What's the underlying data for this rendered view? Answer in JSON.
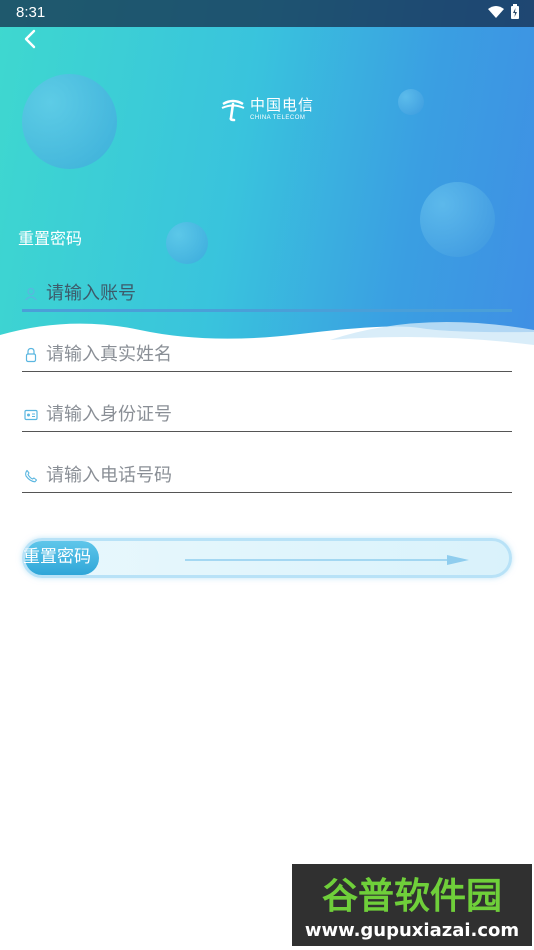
{
  "status_bar": {
    "time": "8:31",
    "wifi_icon": "wifi-icon",
    "battery_icon": "battery-charging-icon"
  },
  "nav": {
    "back_icon": "chevron-left-icon"
  },
  "brand": {
    "name_cn": "中国电信",
    "name_en": "CHINA TELECOM"
  },
  "page": {
    "title": "重置密码"
  },
  "form": {
    "account": {
      "placeholder": "请输入账号",
      "value": "",
      "icon": "user-icon"
    },
    "real_name": {
      "placeholder": "请输入真实姓名",
      "value": "",
      "icon": "lock-icon"
    },
    "id_number": {
      "placeholder": "请输入身份证号",
      "value": "",
      "icon": "id-card-icon"
    },
    "phone": {
      "placeholder": "请输入电话号码",
      "value": "",
      "icon": "phone-icon"
    }
  },
  "slider": {
    "label": "重置密码",
    "progress": 0
  },
  "watermark": {
    "cn": "谷普软件园",
    "url": "www.gupuxiazai.com"
  },
  "colors": {
    "hero_start": "#3ed8cf",
    "hero_end": "#3f8fe4",
    "accent": "#4a9fd8",
    "slider_knob": "#2fa6d8"
  }
}
